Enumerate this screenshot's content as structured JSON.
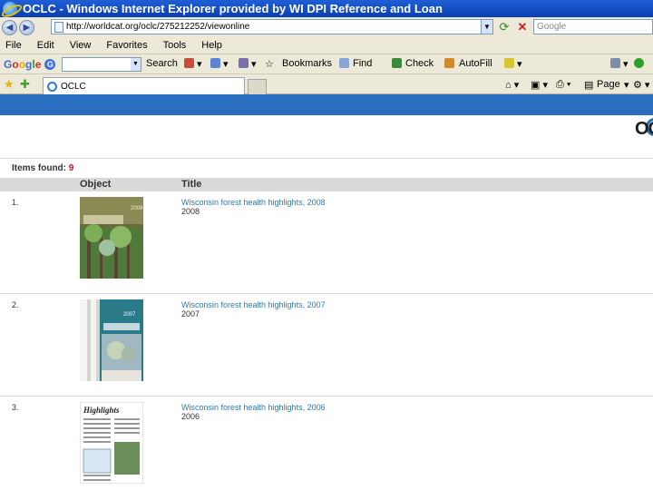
{
  "window": {
    "title": "OCLC - Windows Internet Explorer provided by WI DPI Reference and Loan"
  },
  "address_bar": {
    "url": "http://worldcat.org/oclc/275212252/viewonline",
    "search_placeholder": "Google"
  },
  "menu": [
    "File",
    "Edit",
    "View",
    "Favorites",
    "Tools",
    "Help"
  ],
  "google_toolbar": {
    "logo": "Google",
    "badge": "G",
    "search_label": "Search",
    "bookmarks_label": "Bookmarks",
    "find_label": "Find",
    "check_label": "Check",
    "autofill_label": "AutoFill"
  },
  "tabs": {
    "active_tab_label": "OCLC"
  },
  "command_bar": {
    "page_label": "Page",
    "tools_label": "Tools"
  },
  "content": {
    "items_found_label": "Items found:",
    "items_found_count": "9",
    "columns": {
      "object": "Object",
      "title": "Title"
    },
    "results": [
      {
        "num": "1.",
        "title": "Wisconsin forest health highlights, 2008",
        "date": "2008",
        "cover_text": "2008"
      },
      {
        "num": "2.",
        "title": "Wisconsin forest health highlights, 2007",
        "date": "2007",
        "cover_text": "2007"
      },
      {
        "num": "3.",
        "title": "Wisconsin forest health highlights, 2006",
        "date": "2006",
        "cover_text": "Highlights"
      }
    ]
  },
  "colors": {
    "banner": "#2a6fc0",
    "link": "#2e7aa8",
    "count": "#c0161a"
  }
}
